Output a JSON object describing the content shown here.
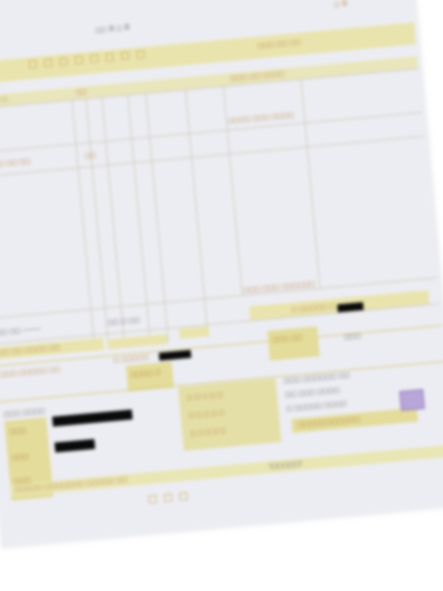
{
  "document": {
    "type": "blurred photo of a printed form",
    "legible_text": []
  },
  "colors": {
    "paper": "#ecedf2",
    "form_band": "#e9e4ae",
    "form_cell": "#e3dc9a",
    "print_text": "#b0732c",
    "redaction": "#0a0a0a",
    "stamp": "#b8a6d8"
  }
}
